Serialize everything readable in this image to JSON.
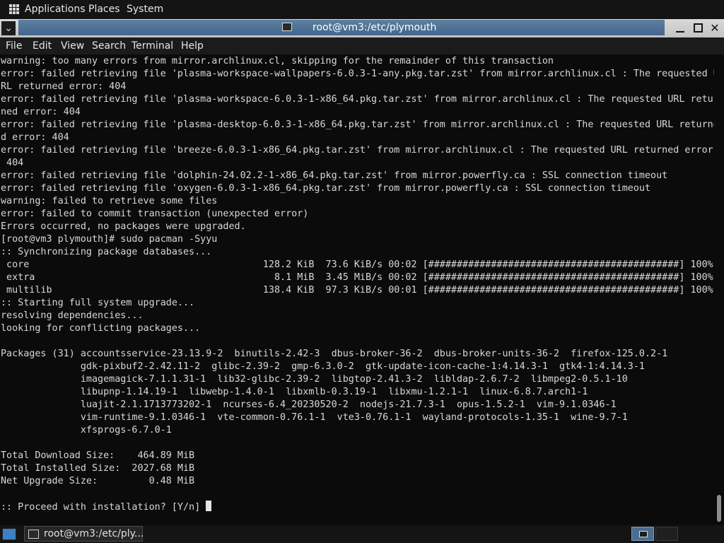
{
  "top_panel": {
    "applications": "Applications",
    "places": "Places",
    "system": "System"
  },
  "window": {
    "title": "root@vm3:/etc/plymouth",
    "collapse_glyph": "⌄",
    "close_glyph": "✕"
  },
  "menu": [
    "File",
    "Edit",
    "View",
    "Search",
    "Terminal",
    "Help"
  ],
  "terminal": {
    "lines": [
      "warning: too many errors from mirror.archlinux.cl, skipping for the remainder of this transaction",
      "error: failed retrieving file 'plasma-workspace-wallpapers-6.0.3-1-any.pkg.tar.zst' from mirror.archlinux.cl : The requested U",
      "RL returned error: 404",
      "error: failed retrieving file 'plasma-workspace-6.0.3-1-x86_64.pkg.tar.zst' from mirror.archlinux.cl : The requested URL retur",
      "ned error: 404",
      "error: failed retrieving file 'plasma-desktop-6.0.3-1-x86_64.pkg.tar.zst' from mirror.archlinux.cl : The requested URL returne",
      "d error: 404",
      "error: failed retrieving file 'breeze-6.0.3-1-x86_64.pkg.tar.zst' from mirror.archlinux.cl : The requested URL returned error:",
      " 404",
      "error: failed retrieving file 'dolphin-24.02.2-1-x86_64.pkg.tar.zst' from mirror.powerfly.ca : SSL connection timeout",
      "error: failed retrieving file 'oxygen-6.0.3-1-x86_64.pkg.tar.zst' from mirror.powerfly.ca : SSL connection timeout",
      "warning: failed to retrieve some files",
      "error: failed to commit transaction (unexpected error)",
      "Errors occurred, no packages were upgraded.",
      "[root@vm3 plymouth]# sudo pacman -Syyu",
      ":: Synchronizing package databases...",
      " core                                         128.2 KiB  73.6 KiB/s 00:02 [############################################] 100%",
      " extra                                          8.1 MiB  3.45 MiB/s 00:02 [############################################] 100%",
      " multilib                                     138.4 KiB  97.3 KiB/s 00:01 [############################################] 100%",
      ":: Starting full system upgrade...",
      "resolving dependencies...",
      "looking for conflicting packages...",
      "",
      "Packages (31) accountsservice-23.13.9-2  binutils-2.42-3  dbus-broker-36-2  dbus-broker-units-36-2  firefox-125.0.2-1",
      "              gdk-pixbuf2-2.42.11-2  glibc-2.39-2  gmp-6.3.0-2  gtk-update-icon-cache-1:4.14.3-1  gtk4-1:4.14.3-1",
      "              imagemagick-7.1.1.31-1  lib32-glibc-2.39-2  libgtop-2.41.3-2  libldap-2.6.7-2  libmpeg2-0.5.1-10",
      "              libupnp-1.14.19-1  libwebp-1.4.0-1  libxmlb-0.3.19-1  libxmu-1.2.1-1  linux-6.8.7.arch1-1",
      "              luajit-2.1.1713773202-1  ncurses-6.4_20230520-2  nodejs-21.7.3-1  opus-1.5.2-1  vim-9.1.0346-1",
      "              vim-runtime-9.1.0346-1  vte-common-0.76.1-1  vte3-0.76.1-1  wayland-protocols-1.35-1  wine-9.7-1",
      "              xfsprogs-6.7.0-1",
      "",
      "Total Download Size:    464.89 MiB",
      "Total Installed Size:  2027.68 MiB",
      "Net Upgrade Size:         0.48 MiB",
      "",
      ":: Proceed with installation? [Y/n] "
    ]
  },
  "taskbar": {
    "task_label": "root@vm3:/etc/ply..."
  },
  "colors": {
    "terminal_bg": "#0b0b0b",
    "terminal_fg": "#d8d8d8",
    "title_accent": "#4f7397",
    "panel_bg": "#141414"
  }
}
